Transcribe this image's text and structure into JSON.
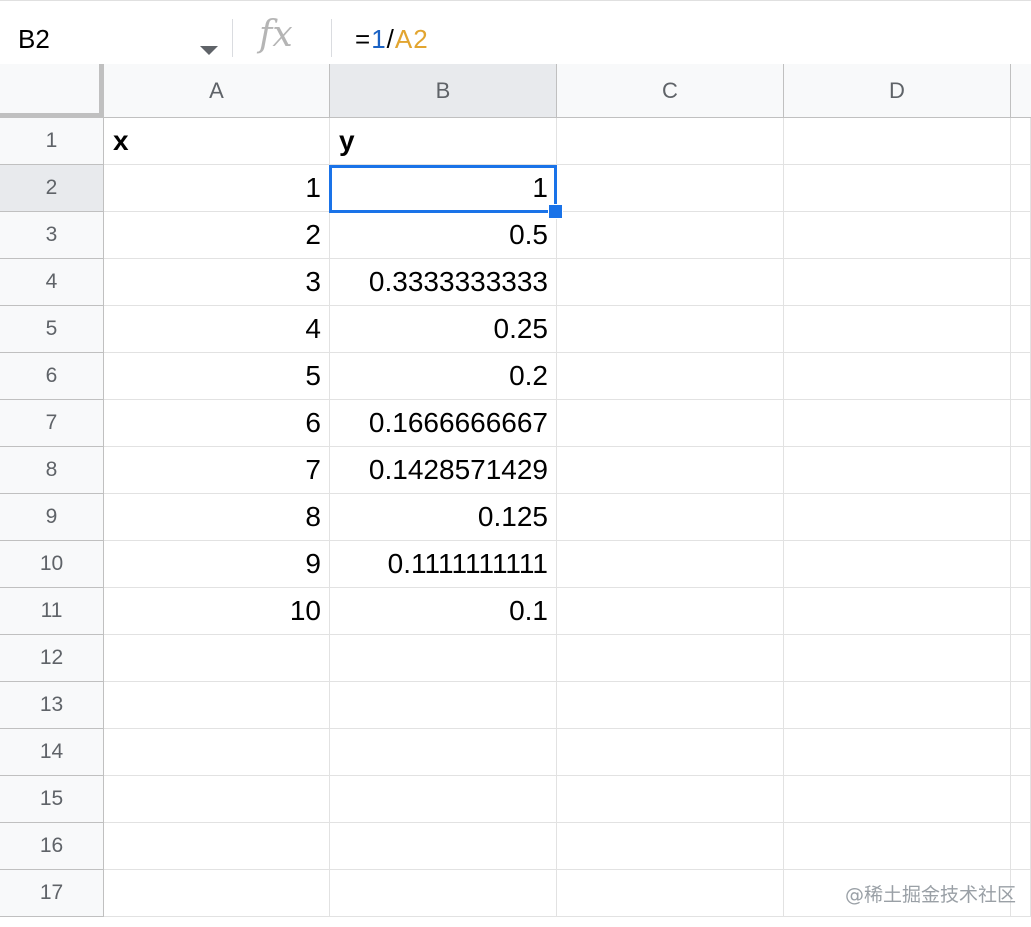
{
  "formula_bar": {
    "name_box": "B2",
    "fx_label": "fx",
    "formula_parts": [
      "=",
      "1",
      "/",
      "A2"
    ]
  },
  "columns": [
    "A",
    "B",
    "C",
    "D"
  ],
  "rows": [
    "1",
    "2",
    "3",
    "4",
    "5",
    "6",
    "7",
    "8",
    "9",
    "10",
    "11",
    "12",
    "13",
    "14",
    "15",
    "16",
    "17"
  ],
  "cells": {
    "headers": [
      "x",
      "y"
    ],
    "data": [
      [
        "1",
        "1"
      ],
      [
        "2",
        "0.5"
      ],
      [
        "3",
        "0.3333333333"
      ],
      [
        "4",
        "0.25"
      ],
      [
        "5",
        "0.2"
      ],
      [
        "6",
        "0.1666666667"
      ],
      [
        "7",
        "0.1428571429"
      ],
      [
        "8",
        "0.125"
      ],
      [
        "9",
        "0.1111111111"
      ],
      [
        "10",
        "0.1"
      ]
    ]
  },
  "selected_cell": "B2",
  "colors": {
    "selection": "#1a73e8",
    "formula_number": "#1a62c4",
    "formula_reference": "#e2a530"
  },
  "watermark": "@稀土掘金技术社区"
}
